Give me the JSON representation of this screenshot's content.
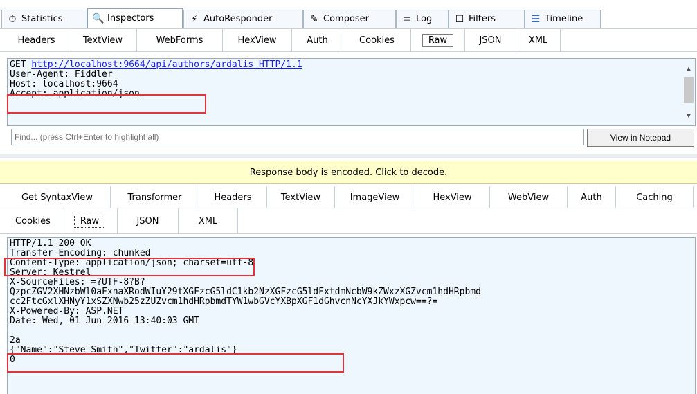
{
  "top_tabs": [
    {
      "label": "Statistics",
      "icon": "statistics-icon",
      "glyph": "⏱"
    },
    {
      "label": "Inspectors",
      "icon": "inspectors-icon",
      "glyph": "🔍"
    },
    {
      "label": "AutoResponder",
      "icon": "autoresponder-icon",
      "glyph": "⚡"
    },
    {
      "label": "Composer",
      "icon": "composer-icon",
      "glyph": "✎"
    },
    {
      "label": "Log",
      "icon": "log-icon",
      "glyph": "≡"
    },
    {
      "label": "Filters",
      "icon": "filters-icon",
      "glyph": "☐"
    },
    {
      "label": "Timeline",
      "icon": "timeline-icon",
      "glyph": "☰"
    }
  ],
  "request": {
    "tabs": [
      "Headers",
      "TextView",
      "WebForms",
      "HexView",
      "Auth",
      "Cookies",
      "Raw",
      "JSON",
      "XML"
    ],
    "active_tab": "Raw",
    "lines": [
      {
        "prefix": "GET ",
        "link": "http://localhost:9664/api/authors/ardalis HTTP/1.1"
      },
      {
        "text": "User-Agent: Fiddler"
      },
      {
        "text": "Host: localhost:9664"
      },
      {
        "text": "Accept: application/json"
      }
    ],
    "find_placeholder": "Find... (press Ctrl+Enter to highlight all)",
    "view_in_notepad": "View in Notepad"
  },
  "banner": "Response body is encoded. Click to decode.",
  "response": {
    "tabs_row1": [
      "Get SyntaxView",
      "Transformer",
      "Headers",
      "TextView",
      "ImageView",
      "HexView",
      "WebView",
      "Auth",
      "Caching"
    ],
    "tabs_row2": [
      "Cookies",
      "Raw",
      "JSON",
      "XML"
    ],
    "active_tab": "Raw",
    "lines": [
      "HTTP/1.1 200 OK",
      "Transfer-Encoding: chunked",
      "Content-Type: application/json; charset=utf-8",
      "Server: Kestrel",
      "X-SourceFiles: =?UTF-8?B?",
      "QzpcZGV2XHNzbWl0aFxnaXRodWIuY29tXGFzcG5ldC1kb2NzXGFzcG5ldFxtdmNcbW9kZWxzXGZvcm1hdHRpbmd",
      "cc2FtcGxlXHNyY1xSZXNwb25zZUZvcm1hdHRpbmdTYW1wbGVcYXBpXGF1dGhvcnNcYXJkYWxpcw==?=",
      "X-Powered-By: ASP.NET",
      "Date: Wed, 01 Jun 2016 13:40:03 GMT",
      "",
      "2a",
      "{\"Name\":\"Steve Smith\",\"Twitter\":\"ardalis\"}",
      "0"
    ]
  },
  "colors": {
    "highlight": "#e0343a",
    "pane_bg": "#eef6fe",
    "banner_bg": "#ffffcc",
    "link": "#1a1aff"
  }
}
